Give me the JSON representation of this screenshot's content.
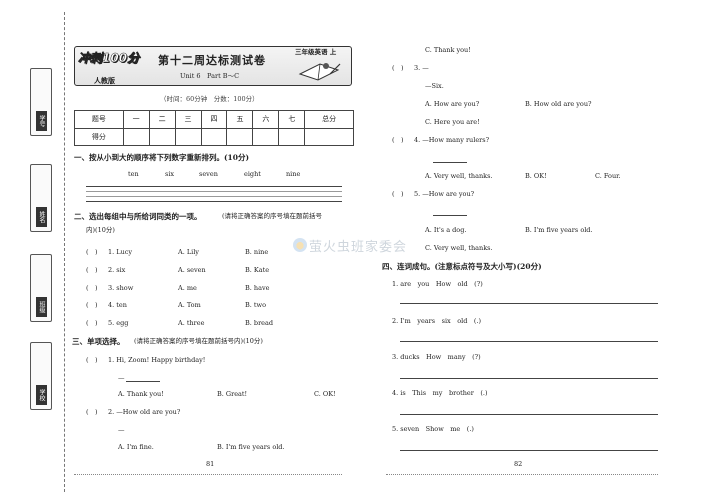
{
  "sidebar": {
    "tabs": [
      "学号",
      "姓名",
      "班级",
      "学校"
    ]
  },
  "header": {
    "logo": "冲刺100分",
    "title": "第十二周达标测试卷",
    "grade": "三年级英语 上",
    "edition": "人教版",
    "unit": "Unit 6　Part B～C",
    "time_score": "（时间：60分钟　分数：100分）"
  },
  "score_table": {
    "header": [
      "题号",
      "一",
      "二",
      "三",
      "四",
      "五",
      "六",
      "七",
      "总分"
    ],
    "row_label": "得分"
  },
  "left": {
    "q1": {
      "heading": "一、按从小到大的顺序将下列数字重新排列。(10分)",
      "words": [
        "ten",
        "six",
        "seven",
        "eight",
        "nine"
      ]
    },
    "q2": {
      "heading": "二、选出每组中与所给词同类的一项。(请将正确答案的序号填在题前括号内)(10分)",
      "heading_a": "二、选出每组中与所给词同类的一项。",
      "heading_b": "(请将正确答案的序号填在题前括号",
      "heading_c": "内)(10分)",
      "items": [
        {
          "bracket": "(　)",
          "num": "1. Lucy",
          "a": "A. Lily",
          "b": "B. nine"
        },
        {
          "bracket": "(　)",
          "num": "2. six",
          "a": "A. seven",
          "b": "B. Kate"
        },
        {
          "bracket": "(　)",
          "num": "3. show",
          "a": "A. me",
          "b": "B. have"
        },
        {
          "bracket": "(　)",
          "num": "4. ten",
          "a": "A. Tom",
          "b": "B. two"
        },
        {
          "bracket": "(　)",
          "num": "5. egg",
          "a": "A. three",
          "b": "B. bread"
        }
      ]
    },
    "q3": {
      "heading_a": "三、单项选择。",
      "heading_b": "(请将正确答案的序号填在题前括号内)(10分)",
      "i1": {
        "bracket": "(　)",
        "q": "1. Hi, Zoom! Happy birthday!",
        "dash": "—",
        "a": "A. Thank you!",
        "b": "B. Great!",
        "c": "C. OK!"
      },
      "i2": {
        "bracket": "(　)",
        "q": "2. —How old are you?",
        "dash": "—",
        "a": "A. I'm fine.",
        "b": "B. I'm five years old."
      }
    },
    "page_num": "81"
  },
  "right": {
    "c_thank": "C. Thank you!",
    "i3": {
      "bracket": "(　)",
      "q": "3. —",
      "reply": "—Six.",
      "a": "A. How are you?",
      "b": "B. How old are you?",
      "c": "C. Here you are!"
    },
    "i4": {
      "bracket": "(　)",
      "q": "4. —How many rulers?",
      "a": "A. Very well, thanks.",
      "b": "B. OK!",
      "c": "C. Four."
    },
    "i5": {
      "bracket": "(　)",
      "q": "5. —How are you?",
      "a": "A. It's a dog.",
      "b": "B. I'm five years old.",
      "c": "C. Very well, thanks."
    },
    "q4": {
      "heading": "四、连词成句。(注意标点符号及大小写)(20分)",
      "items": [
        "1. are　you　How　old　(?)",
        "2. I'm　years　six　old　(.)",
        "3. ducks　How　many　(?)",
        "4. is　This　my　brother　(.)",
        "5. seven　Show　me　(.)"
      ]
    },
    "page_num": "82"
  },
  "watermark": "萤火虫班家委会"
}
